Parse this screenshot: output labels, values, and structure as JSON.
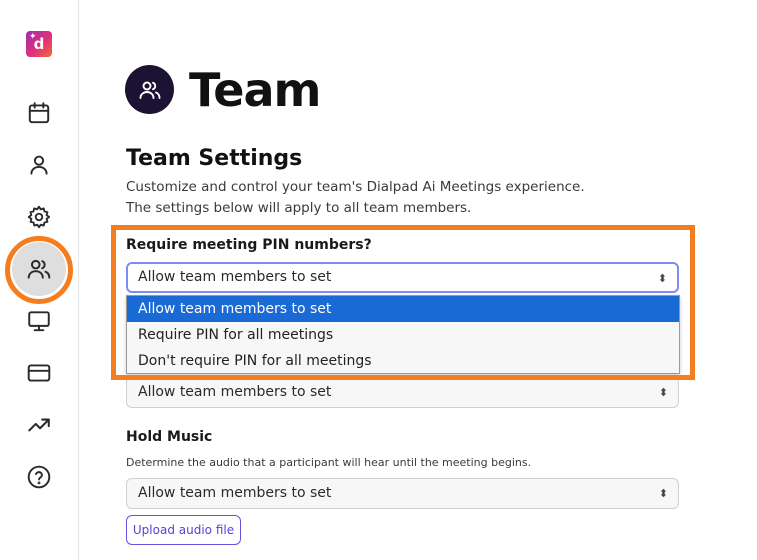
{
  "sidebar": {
    "logo_letter": "d",
    "items": [
      {
        "name": "calendar",
        "icon": "calendar-icon"
      },
      {
        "name": "profile",
        "icon": "user-icon"
      },
      {
        "name": "settings",
        "icon": "gear-icon"
      },
      {
        "name": "team",
        "icon": "team-icon",
        "active": true
      },
      {
        "name": "display",
        "icon": "monitor-icon"
      },
      {
        "name": "billing",
        "icon": "credit-card-icon"
      },
      {
        "name": "analytics",
        "icon": "trending-up-icon"
      },
      {
        "name": "help",
        "icon": "help-circle-icon"
      }
    ]
  },
  "header": {
    "title": "Team",
    "icon": "team-icon"
  },
  "settings": {
    "title": "Team Settings",
    "desc_line1": "Customize and control your team's Dialpad Ai Meetings experience.",
    "desc_line2": "The settings below will apply to all team members.",
    "pin": {
      "label": "Require meeting PIN numbers?",
      "value": "Allow team members to set",
      "options": [
        "Allow team members to set",
        "Require PIN for all meetings",
        "Don't require PIN for all meetings"
      ],
      "selected_index": 0
    },
    "hidden_setting": {
      "value": "Allow team members to set"
    },
    "hold_music": {
      "label": "Hold Music",
      "desc": "Determine the audio that a participant will hear until the meeting begins.",
      "value": "Allow team members to set",
      "upload_label": "Upload audio file"
    }
  },
  "colors": {
    "accent_orange": "#f47d20",
    "selected_blue": "#1a6ad6",
    "brand_purple": "#6b4fe0"
  }
}
